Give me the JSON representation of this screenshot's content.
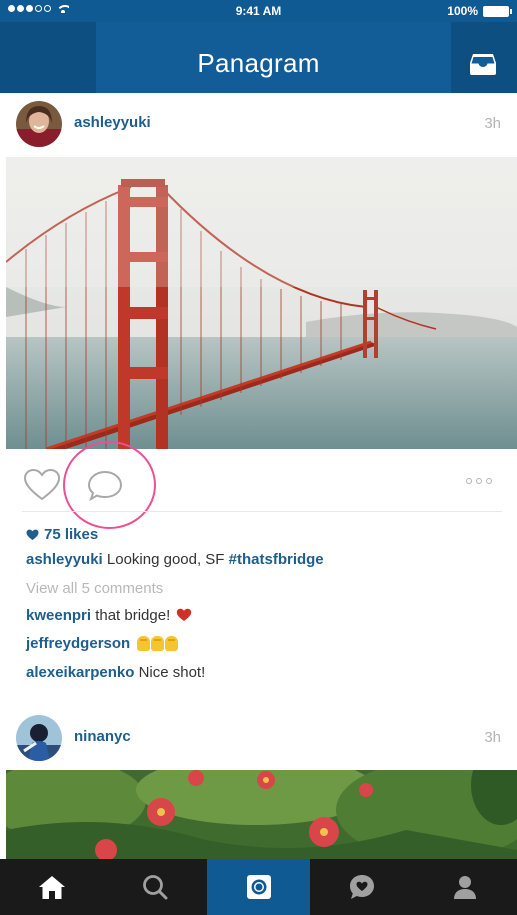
{
  "status_bar": {
    "time": "9:41 AM",
    "battery": "100%"
  },
  "nav": {
    "title": "Panagram",
    "inbox_icon": "inbox-icon"
  },
  "posts": [
    {
      "username": "ashleyyuki",
      "time": "3h",
      "likes": "75 likes",
      "caption": {
        "user": "ashleyyuki",
        "text": " Looking good, SF ",
        "hashtag": "#thatsfbridge"
      },
      "view_all": "View all 5 comments",
      "comments": [
        {
          "user": "kweenpri",
          "text": " that bridge!",
          "emoji": "red-heart"
        },
        {
          "user": "jeffreydgerson",
          "text": "",
          "emoji": "raising-hands"
        },
        {
          "user": "alexeikarpenko",
          "text": " Nice shot!",
          "emoji": ""
        }
      ]
    },
    {
      "username": "ninanyc",
      "time": "3h"
    }
  ],
  "tab_bar": {
    "tabs": [
      {
        "name": "home",
        "icon": "home-icon"
      },
      {
        "name": "search",
        "icon": "search-icon"
      },
      {
        "name": "camera",
        "icon": "camera-icon",
        "active": true
      },
      {
        "name": "activity",
        "icon": "activity-icon"
      },
      {
        "name": "profile",
        "icon": "profile-icon"
      }
    ]
  },
  "colors": {
    "brand": "#125d97",
    "link": "#1f5e8c",
    "highlight": "#ec4f93",
    "tab_bar": "#1a1a1a"
  }
}
